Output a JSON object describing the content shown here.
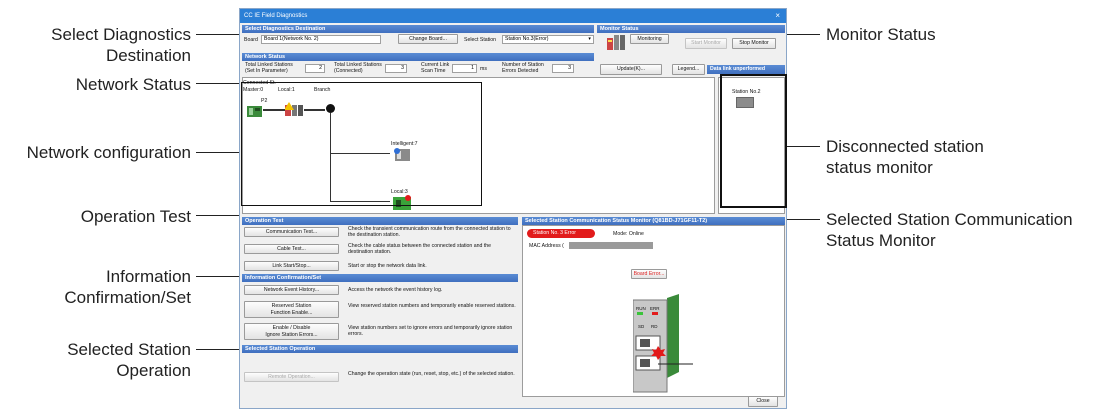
{
  "callouts": {
    "select_diag_1": "Select Diagnostics",
    "select_diag_2": "Destination",
    "network_status": "Network Status",
    "network_config": "Network configuration",
    "operation_test": "Operation Test",
    "info_conf_1": "Information",
    "info_conf_2": "Confirmation/Set",
    "sel_station_op_1": "Selected Station",
    "sel_station_op_2": "Operation",
    "monitor_status": "Monitor Status",
    "disconnected_1": "Disconnected station",
    "disconnected_2": "status monitor",
    "sel_comm_1": "Selected Station Communication",
    "sel_comm_2": "Status Monitor"
  },
  "window": {
    "title": "CC IE Field Diagnostics",
    "close_glyph": "×"
  },
  "select_dest": {
    "header": "Select Diagnostics Destination",
    "board_label": "Board",
    "board_value": "Board 1(Network No. 2)",
    "change_board": "Change Board...",
    "select_station_label": "Select Station",
    "station_value": "Station No.3(Error)"
  },
  "monitor_status": {
    "header": "Monitor Status",
    "monitoring": "Monitoring",
    "start": "Start Monitor",
    "stop": "Stop Monitor"
  },
  "network_status": {
    "header": "Network Status",
    "total_param_label": "Total Linked Stations\n(Set In Parameter)",
    "total_param_value": "2",
    "total_conn_label": "Total Linked Stations\n(Connected)",
    "total_conn_value": "3",
    "scan_label": "Current Link\nScan Time",
    "scan_value": "1",
    "scan_unit": "ms",
    "errors_label": "Number of Station\nErrors Detected",
    "errors_value": "3",
    "update": "Update(K)...",
    "legend": "Legend...",
    "data_link": "Data link unperformed"
  },
  "network_config": {
    "connected": "Connected St.",
    "master": "Master:0",
    "p2": "P2",
    "local1": "Local:1",
    "branch": "Branch",
    "intelligent": "Intelligent:7",
    "local3": "Local:3"
  },
  "disconnected": {
    "station": "Station No.2"
  },
  "operation_test": {
    "header": "Operation Test",
    "comm_test": "Communication Test...",
    "comm_desc": "Check the transient communication route from the connected station to the destination station.",
    "cable_test": "Cable Test...",
    "cable_desc": "Check the cable status between the connected station and the destination station.",
    "link": "Link Start/Stop...",
    "link_desc": "Start or stop the network data link."
  },
  "info_conf": {
    "header": "Information Confirmation/Set",
    "event": "Network Event History...",
    "event_desc": "Access the network the event history log.",
    "reserved": "Reserved Station\nFunction Enable...",
    "reserved_desc": "View reserved station numbers and temporarily enable reserved stations.",
    "ignore": "Enable / Disable\nIgnore Station Errors...",
    "ignore_desc": "View station numbers set to ignore errors and temporarily ignore station errors."
  },
  "sel_op": {
    "header": "Selected Station Operation",
    "remote": "Remote Operation...",
    "remote_desc": "Change the operation state (run, reset, stop, etc.) of the selected station."
  },
  "sel_comm": {
    "header": "Selected Station Communication Status Monitor (Q81BD-J71GF11-T2)",
    "station": "Station No. 3   Error",
    "mode": "Mode:   Online",
    "mac": "MAC Address (",
    "board_error": "Board Error...",
    "run": "RUN",
    "err": "ERR",
    "sd": "SD",
    "rd": "RD"
  },
  "footer": {
    "close": "Close"
  },
  "colors": {
    "title_blue": "#2b7fd6",
    "section_blue": "#3f6fbf",
    "error_red": "#e21b1b",
    "board_green": "#3a8a3a"
  }
}
